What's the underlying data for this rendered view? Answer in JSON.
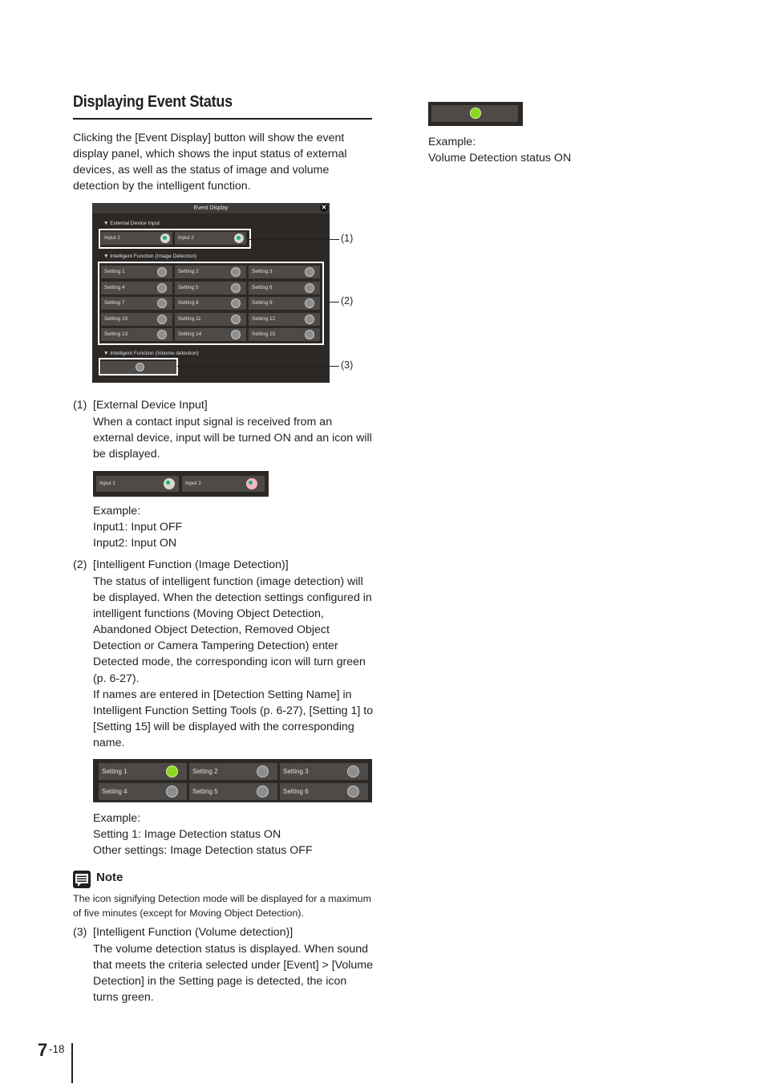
{
  "heading": "Displaying Event Status",
  "intro": "Clicking the [Event Display] button will show the event display panel, which shows the input status of external devices, as well as the status of image and volume detection by the intelligent function.",
  "panel": {
    "title": "Event Display",
    "close_icon": "✕",
    "sections": {
      "external": "▼ External Device Input",
      "image": "▼ Intelligent Function (Image Detection)",
      "volume": "▼ Intelligent Function (Volume detection)"
    },
    "inputs": [
      "Input 1",
      "Input 2"
    ],
    "settings": [
      "Setting 1",
      "Setting 2",
      "Setting 3",
      "Setting 4",
      "Setting 5",
      "Setting 6",
      "Setting 7",
      "Setting 8",
      "Setting 9",
      "Setting 10",
      "Setting 11",
      "Setting 12",
      "Setting 13",
      "Setting 14",
      "Setting 15"
    ],
    "callouts": [
      "(1)",
      "(2)",
      "(3)"
    ]
  },
  "items": [
    {
      "number": "(1)",
      "title": "[External Device Input]",
      "body": "When a contact input signal is received from an external device, input will be turned ON and an icon will be displayed.",
      "example_strip": {
        "inputs": [
          {
            "label": "Input 1",
            "state": "off"
          },
          {
            "label": "Input 2",
            "state": "on"
          }
        ]
      },
      "example": [
        "Example:",
        "Input1: Input OFF",
        "Input2: Input ON"
      ]
    },
    {
      "number": "(2)",
      "title": "[Intelligent Function (Image Detection)]",
      "body": "The status of intelligent function (image detection) will be displayed. When the detection settings configured in intelligent functions (Moving Object Detection, Abandoned Object Detection, Removed Object Detection or Camera Tampering Detection) enter Detected mode, the corresponding icon will turn green (p. 6-27).",
      "body2": "If names are entered in [Detection Setting Name] in Intelligent Function Setting Tools (p. 6-27), [Setting 1] to [Setting 15] will be displayed with the corresponding name.",
      "example_strip": {
        "settings": [
          {
            "label": "Setting 1",
            "state": "on"
          },
          {
            "label": "Setting 2",
            "state": "off"
          },
          {
            "label": "Setting 3",
            "state": "off"
          },
          {
            "label": "Setting 4",
            "state": "off"
          },
          {
            "label": "Setting 5",
            "state": "off"
          },
          {
            "label": "Setting 6",
            "state": "off"
          }
        ]
      },
      "example": [
        "Example:",
        "Setting 1: Image Detection status ON",
        "Other settings: Image Detection status OFF"
      ]
    },
    {
      "number": "(3)",
      "title": "[Intelligent Function (Volume detection)]",
      "body": "The volume detection status is displayed. When sound that meets the criteria selected under [Event] > [Volume Detection] in the Setting page is detected, the icon turns green.",
      "example": [
        "Example:",
        "Volume Detection status ON"
      ]
    }
  ],
  "note": {
    "title": "Note",
    "body": "The icon signifying Detection mode will be displayed for a maximum of five minutes (except for Moving Object Detection)."
  },
  "page": {
    "chapter": "7",
    "sub": "-18"
  }
}
